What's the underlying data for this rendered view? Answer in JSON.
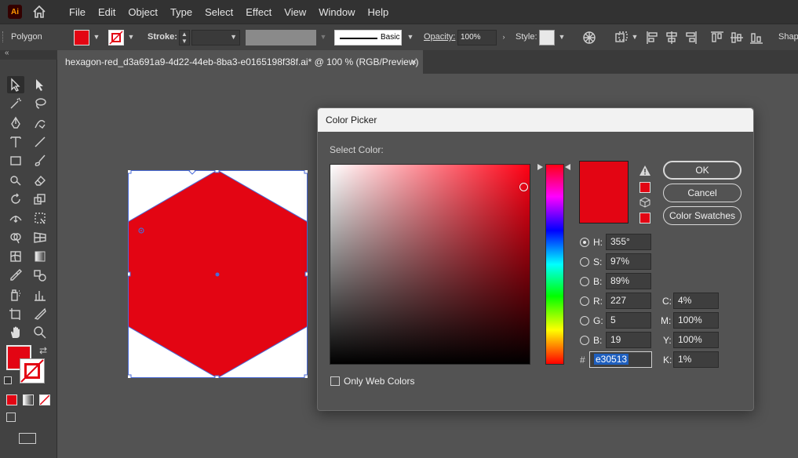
{
  "app": {
    "logo": "Ai"
  },
  "menu": [
    "File",
    "Edit",
    "Object",
    "Type",
    "Select",
    "Effect",
    "View",
    "Window",
    "Help"
  ],
  "control_bar": {
    "object_type": "Polygon",
    "stroke_label": "Stroke:",
    "brush_label": "Basic",
    "opacity_label": "Opacity:",
    "opacity_value": "100%",
    "style_label": "Style:",
    "shape_label": "Shape",
    "fill_color": "#e30513"
  },
  "document_tab": {
    "title": "hexagon-red_d3a691a9-4d22-44eb-8ba3-e0165198f38f.ai* @ 100 % (RGB/Preview)",
    "close": "×"
  },
  "color_picker": {
    "title": "Color Picker",
    "select_color_label": "Select Color:",
    "buttons": {
      "ok": "OK",
      "cancel": "Cancel",
      "swatches": "Color Swatches"
    },
    "hsb": [
      {
        "label": "H:",
        "value": "355°",
        "selected": true
      },
      {
        "label": "S:",
        "value": "97%",
        "selected": false
      },
      {
        "label": "B:",
        "value": "89%",
        "selected": false
      }
    ],
    "rgb": [
      {
        "label": "R:",
        "value": "227"
      },
      {
        "label": "G:",
        "value": "5"
      },
      {
        "label": "B:",
        "value": "19"
      }
    ],
    "cmyk": [
      {
        "label": "C:",
        "value": "4%"
      },
      {
        "label": "M:",
        "value": "100%"
      },
      {
        "label": "Y:",
        "value": "100%"
      },
      {
        "label": "K:",
        "value": "1%"
      }
    ],
    "hex_label": "#",
    "hex_value": "e30513",
    "only_web_colors_label": "Only Web Colors",
    "new_color": "#e30513"
  },
  "colors": {
    "shape_fill": "#e30513",
    "selection": "#4a6bd8"
  }
}
